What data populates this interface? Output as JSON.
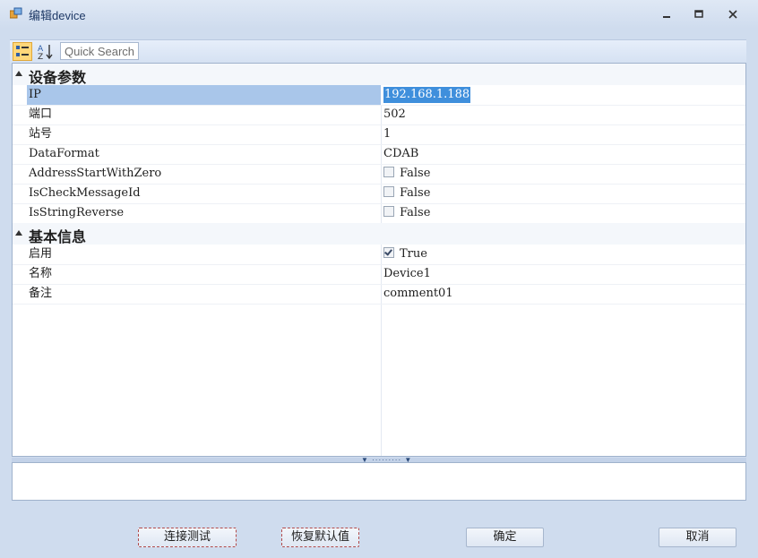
{
  "window": {
    "title": "编辑device",
    "app_icon": "window-app-icon",
    "controls": [
      "minimize-icon",
      "restore-icon",
      "close-icon"
    ]
  },
  "toolbar": {
    "categorized_icon": "categorized-view-icon",
    "alphabetical_icon": "alphabetical-sort-icon",
    "search_placeholder": "Quick Search"
  },
  "grid": {
    "categories": [
      {
        "label": "设备参数",
        "rows": [
          {
            "name": "IP",
            "value": "192.168.1.188",
            "selected": true
          },
          {
            "name": "端口",
            "value": "502"
          },
          {
            "name": "站号",
            "value": "1"
          },
          {
            "name": "DataFormat",
            "value": "CDAB"
          },
          {
            "name": "AddressStartWithZero",
            "value": "False",
            "checkbox": false
          },
          {
            "name": "IsCheckMessageId",
            "value": "False",
            "checkbox": false
          },
          {
            "name": "IsStringReverse",
            "value": "False",
            "checkbox": false
          }
        ]
      },
      {
        "label": "基本信息",
        "rows": [
          {
            "name": "启用",
            "value": "True",
            "checkbox": true
          },
          {
            "name": "名称",
            "value": "Device1"
          },
          {
            "name": "备注",
            "value": "comment01"
          }
        ]
      }
    ]
  },
  "buttons": {
    "test": "连接测试",
    "reset": "恢复默认值",
    "ok": "确定",
    "cancel": "取消"
  },
  "colors": {
    "selection": "#3f8fdc",
    "row_selected": "#a9c6ea",
    "window_bg": "#cfdcee"
  }
}
